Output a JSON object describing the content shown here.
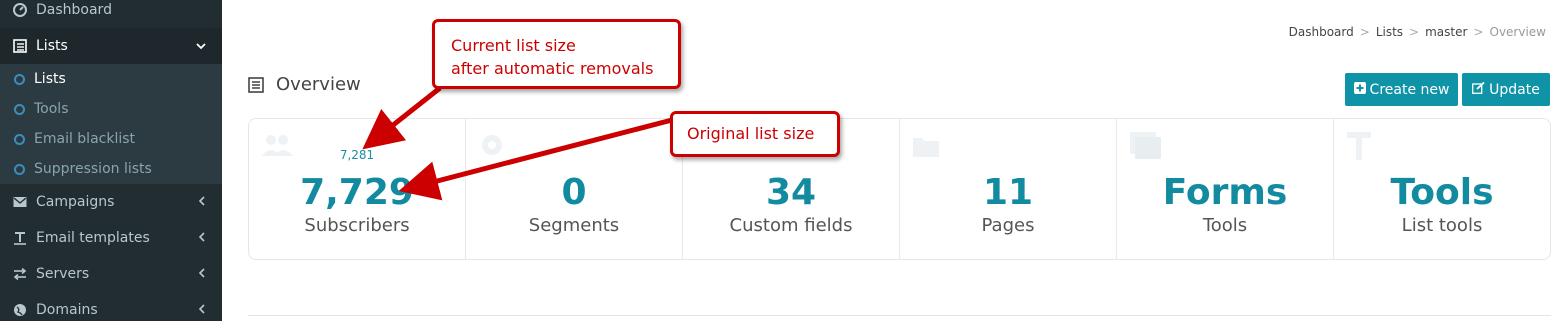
{
  "sidebar": {
    "items": [
      {
        "label": "Dashboard",
        "icon": "dashboard-icon"
      },
      {
        "label": "Lists",
        "icon": "list-icon",
        "active": true
      },
      {
        "label": "Campaigns",
        "icon": "envelope-icon"
      },
      {
        "label": "Email templates",
        "icon": "text-icon"
      },
      {
        "label": "Servers",
        "icon": "exchange-icon"
      },
      {
        "label": "Domains",
        "icon": "globe-icon"
      }
    ],
    "submenu": [
      {
        "label": "Lists",
        "active": true
      },
      {
        "label": "Tools"
      },
      {
        "label": "Email blacklist"
      },
      {
        "label": "Suppression lists"
      }
    ]
  },
  "breadcrumb": [
    "Dashboard",
    "Lists",
    "master",
    "Overview"
  ],
  "page_title": "Overview",
  "buttons": {
    "create": "Create new",
    "update": "Update"
  },
  "stats": [
    {
      "small": "7,281",
      "value": "7,729",
      "label": "Subscribers",
      "icon": "users-icon"
    },
    {
      "small": "",
      "value": "0",
      "label": "Segments",
      "icon": "gear-icon"
    },
    {
      "small": "",
      "value": "34",
      "label": "Custom fields",
      "icon": "list-icon"
    },
    {
      "small": "",
      "value": "11",
      "label": "Pages",
      "icon": "folder-icon"
    },
    {
      "small": "",
      "value": "Forms",
      "label": "Tools",
      "icon": "copy-icon"
    },
    {
      "small": "",
      "value": "Tools",
      "label": "List tools",
      "icon": "text-icon"
    }
  ],
  "callouts": {
    "current_line1": "Current list size",
    "current_line2": "after automatic removals",
    "original": "Original list size"
  },
  "colors": {
    "accent": "#0f94a7",
    "annotation": "#cc0000",
    "sidebar": "#222d32"
  }
}
